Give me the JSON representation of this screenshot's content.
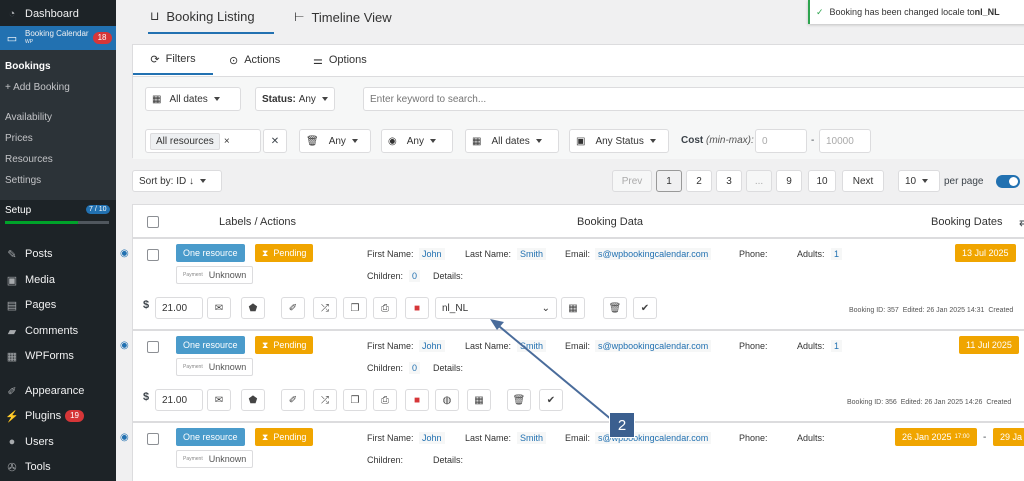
{
  "sidebar": {
    "dashboard": "Dashboard",
    "booking_calendar": "Booking Calendar",
    "booking_calendar_sub": "WP",
    "booking_badge": "18",
    "bookings": "Bookings",
    "add_booking": "+ Add Booking",
    "availability": "Availability",
    "prices": "Prices",
    "resources": "Resources",
    "settings": "Settings",
    "setup": "Setup",
    "setup_progress": "7 / 10",
    "setup_fraction": 0.7,
    "posts": "Posts",
    "media": "Media",
    "pages": "Pages",
    "comments": "Comments",
    "wpforms": "WPForms",
    "appearance": "Appearance",
    "plugins": "Plugins",
    "plugins_badge": "19",
    "users": "Users",
    "tools": "Tools"
  },
  "top_tabs": {
    "booking_listing": "Booking Listing",
    "timeline_view": "Timeline View"
  },
  "notice": {
    "text": "Booking has been changed locale to ",
    "value": "nl_NL"
  },
  "filter_tabs": {
    "filters": "Filters",
    "actions": "Actions",
    "options": "Options"
  },
  "filters": {
    "dates": "All dates",
    "status_label": "Status:",
    "status_value": "Any",
    "search_placeholder": "Enter keyword to search...",
    "resources": "All resources",
    "trash": "Any",
    "visibility": "Any",
    "dates2": "All dates",
    "payment_status": "Any Status",
    "cost_label": "Cost",
    "cost_hint": "(min-max):",
    "cost_min": "0",
    "cost_max": "10000"
  },
  "sort": {
    "label": "Sort by:",
    "value": "ID ↓"
  },
  "pagination": {
    "prev": "Prev",
    "pages": [
      "1",
      "2",
      "3",
      "...",
      "9",
      "10"
    ],
    "next": "Next",
    "per_page_value": "10",
    "per_page_label": "per page"
  },
  "table_headers": {
    "labels": "Labels / Actions",
    "data": "Booking Data",
    "dates": "Booking Dates"
  },
  "bookings": [
    {
      "resource": "One resource",
      "status": "Pending",
      "payment_label": "Payment",
      "payment": "Unknown",
      "first_name_k": "First Name:",
      "first_name": "John",
      "last_name_k": "Last Name:",
      "last_name": "Smith",
      "email_k": "Email:",
      "email": "s@wpbookingcalendar.com",
      "phone_k": "Phone:",
      "adults_k": "Adults:",
      "adults": "1",
      "children_k": "Children:",
      "children": "0",
      "details_k": "Details:",
      "date": "13 Jul 2025",
      "cost": "21.00",
      "locale": "nl_NL",
      "meta_id": "Booking ID: 357",
      "meta_edited": "Edited: 26 Jan 2025 14:31",
      "meta_created": "Created"
    },
    {
      "resource": "One resource",
      "status": "Pending",
      "payment_label": "Payment",
      "payment": "Unknown",
      "first_name_k": "First Name:",
      "first_name": "John",
      "last_name_k": "Last Name:",
      "last_name": "Smith",
      "email_k": "Email:",
      "email": "s@wpbookingcalendar.com",
      "phone_k": "Phone:",
      "adults_k": "Adults:",
      "adults": "1",
      "children_k": "Children:",
      "children": "0",
      "details_k": "Details:",
      "date": "11 Jul 2025",
      "cost": "21.00",
      "meta_id": "Booking ID: 356",
      "meta_edited": "Edited: 26 Jan 2025 14:26",
      "meta_created": "Created"
    },
    {
      "resource": "One resource",
      "status": "Pending",
      "payment_label": "Payment",
      "payment": "Unknown",
      "first_name_k": "First Name:",
      "first_name": "John",
      "last_name_k": "Last Name:",
      "last_name": "Smith",
      "email_k": "Email:",
      "email": "s@wpbookingcalendar.com",
      "phone_k": "Phone:",
      "adults_k": "Adults:",
      "children_k": "Children:",
      "details_k": "Details:",
      "date_start": "26 Jan 2025",
      "time": "17:00",
      "date_sep": "-",
      "date_end": "29 Ja"
    }
  ],
  "annotation": {
    "number": "2"
  },
  "colors": {
    "sidebar": "#1d2327",
    "accent": "#2271b1",
    "pending": "#f0a500",
    "resource": "#4a9bcb",
    "badge": "#d63638"
  }
}
